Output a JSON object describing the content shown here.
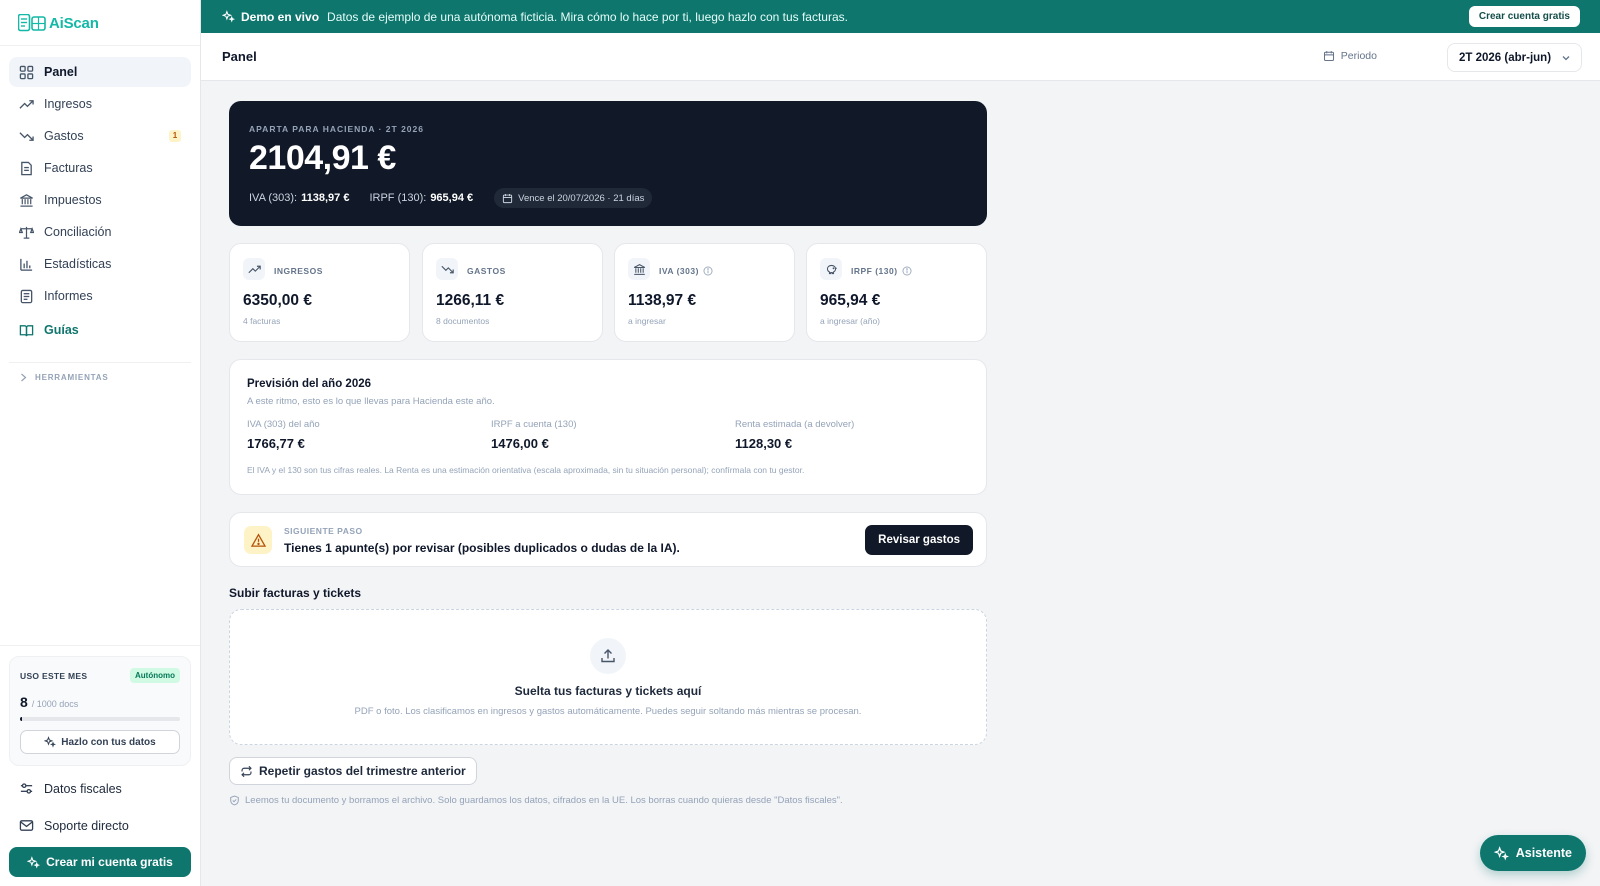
{
  "app": {
    "name": "AiScan"
  },
  "sidebar": {
    "items": [
      {
        "label": "Panel",
        "icon": "dashboard-icon"
      },
      {
        "label": "Ingresos",
        "icon": "trending-up-icon"
      },
      {
        "label": "Gastos",
        "icon": "trending-down-icon",
        "badge": "1"
      },
      {
        "label": "Facturas",
        "icon": "document-icon"
      },
      {
        "label": "Impuestos",
        "icon": "bank-icon"
      },
      {
        "label": "Conciliación",
        "icon": "scale-icon"
      },
      {
        "label": "Estadísticas",
        "icon": "bar-chart-icon"
      },
      {
        "label": "Informes",
        "icon": "report-icon"
      },
      {
        "label": "Guías",
        "icon": "book-icon"
      }
    ],
    "tools_label": "HERRAMIENTAS",
    "usage": {
      "title": "USO ESTE MES",
      "plan": "Autónomo",
      "count": "8",
      "limit": "/ 1000 docs",
      "fraction": 0.008,
      "button": "Hazlo con tus datos"
    },
    "fiscal_link": "Datos fiscales",
    "support_link": "Soporte directo",
    "cta": "Crear mi cuenta gratis"
  },
  "banner": {
    "strong": "Demo en vivo",
    "text": "Datos de ejemplo de una autónoma ficticia. Mira cómo lo hace por ti, luego hazlo con tus facturas.",
    "button": "Crear cuenta gratis"
  },
  "header": {
    "title": "Panel",
    "period_label": "Periodo",
    "period_value": "2T 2026 (abr-jun)"
  },
  "hero": {
    "label": "APARTA PARA HACIENDA · 2T 2026",
    "amount": "2104,91 €",
    "iva_label": "IVA (303):",
    "iva_value": "1138,97 €",
    "irpf_label": "IRPF (130):",
    "irpf_value": "965,94 €",
    "due": "Vence el 20/07/2026 · 21 días"
  },
  "stats": [
    {
      "label": "INGRESOS",
      "value": "6350,00 €",
      "sub": "4 facturas"
    },
    {
      "label": "GASTOS",
      "value": "1266,11 €",
      "sub": "8 documentos"
    },
    {
      "label": "IVA (303)",
      "value": "1138,97 €",
      "sub": "a ingresar"
    },
    {
      "label": "IRPF (130)",
      "value": "965,94 €",
      "sub": "a ingresar (año)"
    }
  ],
  "forecast": {
    "title": "Previsión del año 2026",
    "subtitle": "A este ritmo, esto es lo que llevas para Hacienda este año.",
    "cols": [
      {
        "label": "IVA (303) del año",
        "value": "1766,77 €"
      },
      {
        "label": "IRPF a cuenta (130)",
        "value": "1476,00 €"
      },
      {
        "label": "Renta estimada (a devolver)",
        "value": "1128,30 €"
      }
    ],
    "note": "El IVA y el 130 son tus cifras reales. La Renta es una estimación orientativa (escala aproximada, sin tu situación personal); confírmala con tu gestor."
  },
  "next_step": {
    "label": "SIGUIENTE PASO",
    "text": "Tienes 1 apunte(s) por revisar (posibles duplicados o dudas de la IA).",
    "button": "Revisar gastos"
  },
  "upload": {
    "title": "Subir facturas y tickets",
    "drop_title": "Suelta tus facturas y tickets aquí",
    "drop_sub": "PDF o foto. Los clasificamos en ingresos y gastos automáticamente. Puedes seguir soltando más mientras se procesan."
  },
  "repeat_button": "Repetir gastos del trimestre anterior",
  "privacy": "Leemos tu documento y borramos el archivo. Solo guardamos los datos, cifrados en la UE. Los borras cuando quieras desde \"Datos fiscales\".",
  "assistant": "Asistente"
}
